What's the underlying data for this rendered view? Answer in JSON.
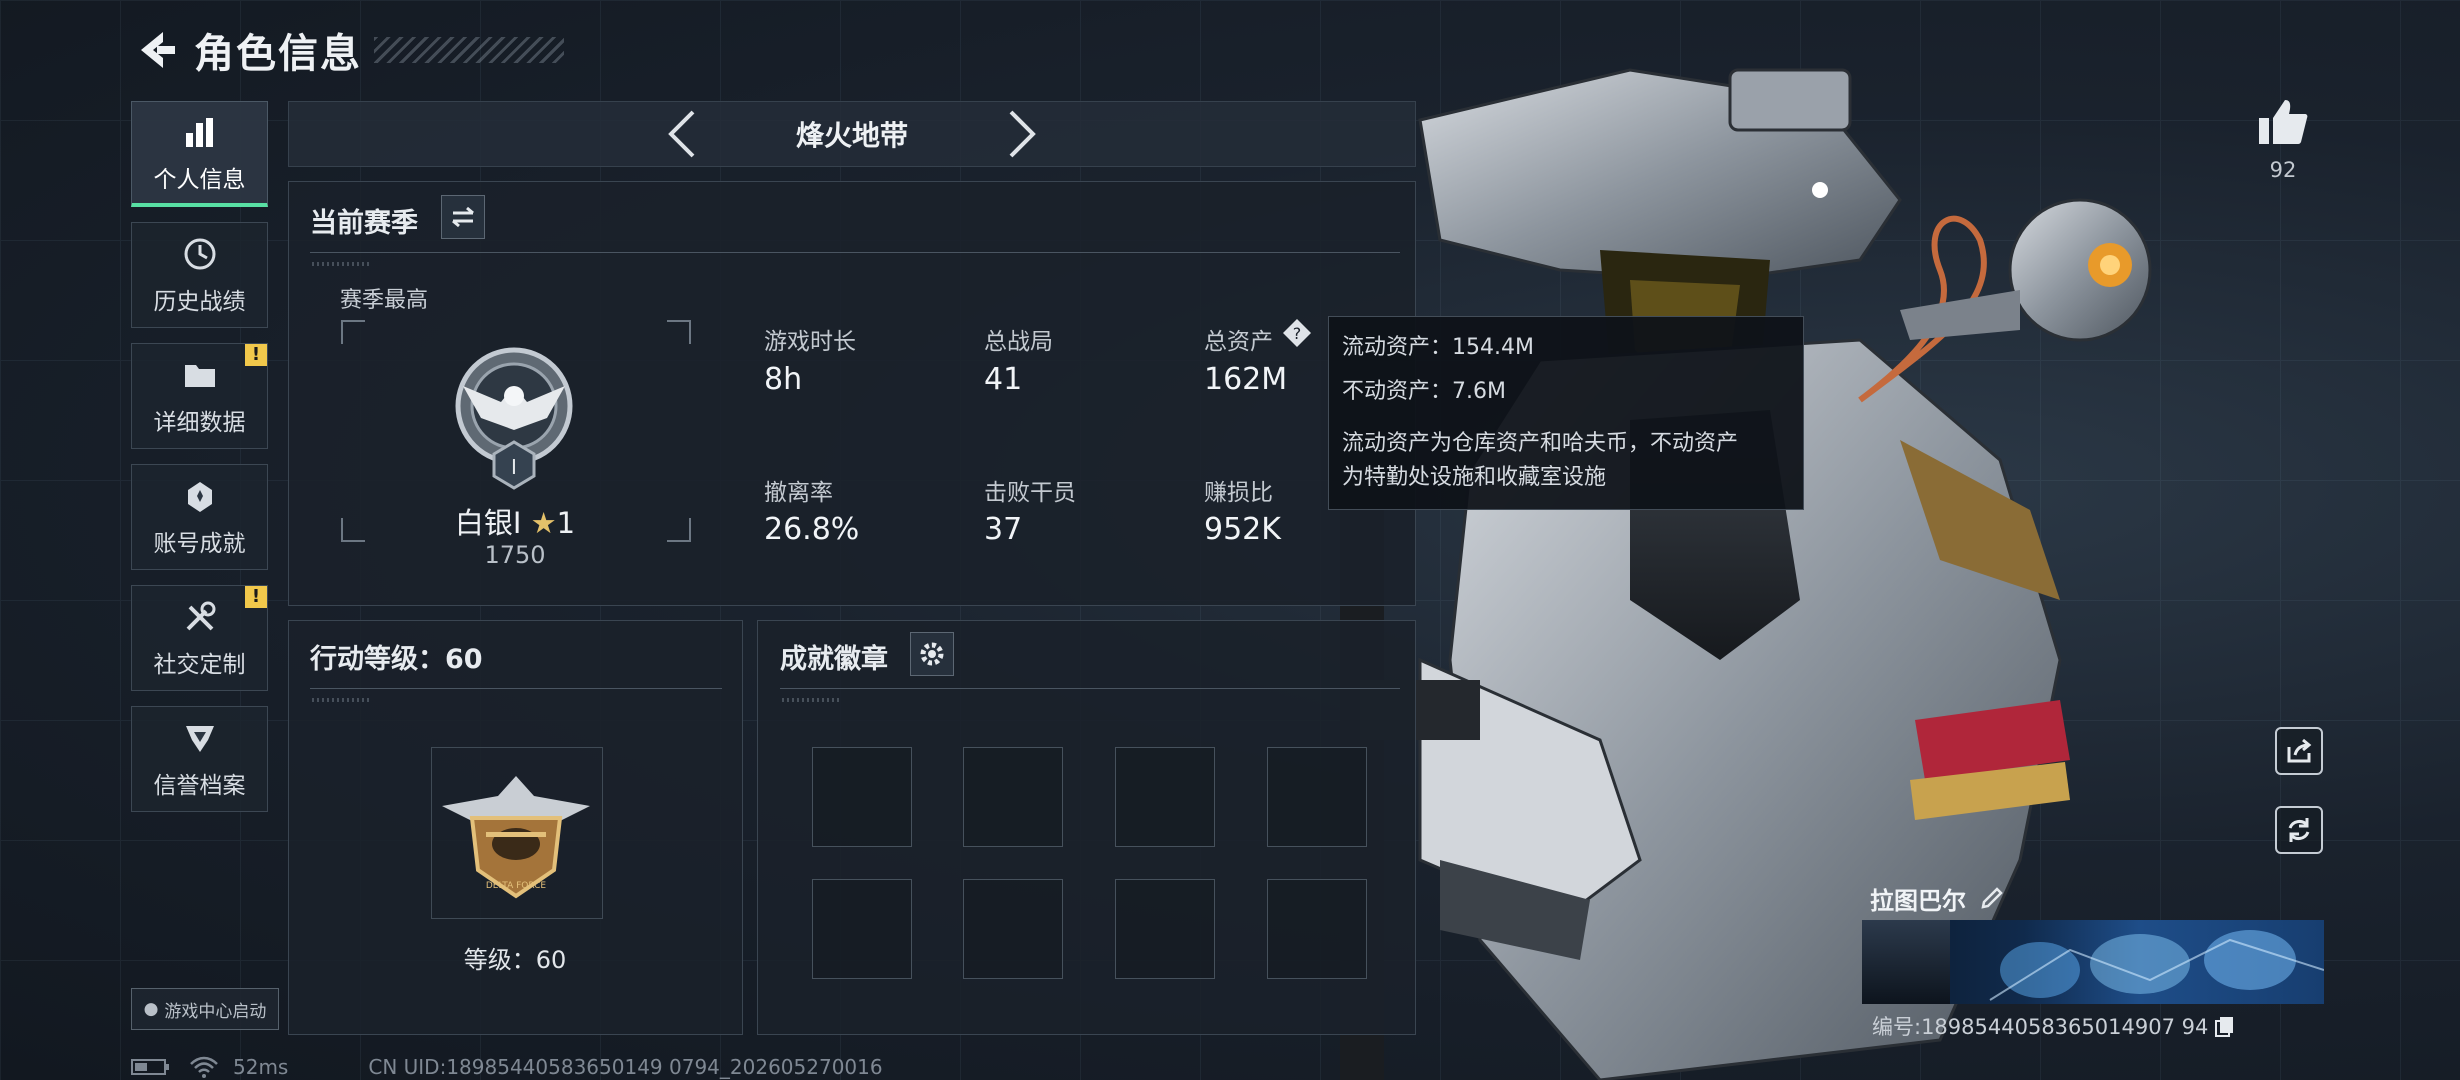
{
  "header": {
    "title": "角色信息"
  },
  "sidebar": {
    "items": [
      {
        "label": "个人信息",
        "active": true,
        "icon": "bar-chart-icon"
      },
      {
        "label": "历史战绩",
        "icon": "history-icon"
      },
      {
        "label": "详细数据",
        "icon": "folder-icon",
        "badge": "!"
      },
      {
        "label": "账号成就",
        "icon": "achievement-icon"
      },
      {
        "label": "社交定制",
        "icon": "tools-icon",
        "badge": "!"
      },
      {
        "label": "信誉档案",
        "icon": "credit-icon"
      }
    ],
    "game_center": "游戏中心启动"
  },
  "mode": {
    "name": "烽火地带"
  },
  "season": {
    "title": "当前赛季",
    "best_label": "赛季最高",
    "rank_name": "白银I",
    "rank_stars": "1",
    "rank_score": "1750",
    "badge_numeral": "I",
    "stats": [
      {
        "label": "游戏时长",
        "value": "8h"
      },
      {
        "label": "总战局",
        "value": "41"
      },
      {
        "label": "总资产",
        "value": "162M"
      },
      {
        "label": "撤离率",
        "value": "26.8%"
      },
      {
        "label": "击败干员",
        "value": "37"
      },
      {
        "label": "赚损比",
        "value": "952K"
      }
    ]
  },
  "tooltip": {
    "liquid": "流动资产：154.4M",
    "fixed": "不动资产：7.6M",
    "note_line1": "流动资产为仓库资产和哈夫币，不动资产",
    "note_line2": "为特勤处设施和收藏室设施"
  },
  "action_level": {
    "title": "行动等级：60",
    "level_text": "等级：60",
    "badge_text": "DELTA FORCE"
  },
  "achievements": {
    "title": "成就徽章"
  },
  "profile": {
    "likes": "92",
    "character_name": "拉图巴尔",
    "uid_line": "编号:1898544058365014907 94"
  },
  "status": {
    "ping": "52ms",
    "cn_uid": "CN UID:18985440583650149 0794_202605270016"
  },
  "colors": {
    "accent": "#58e0a4",
    "warning": "#f1c84b",
    "text": "#eef1f4"
  }
}
